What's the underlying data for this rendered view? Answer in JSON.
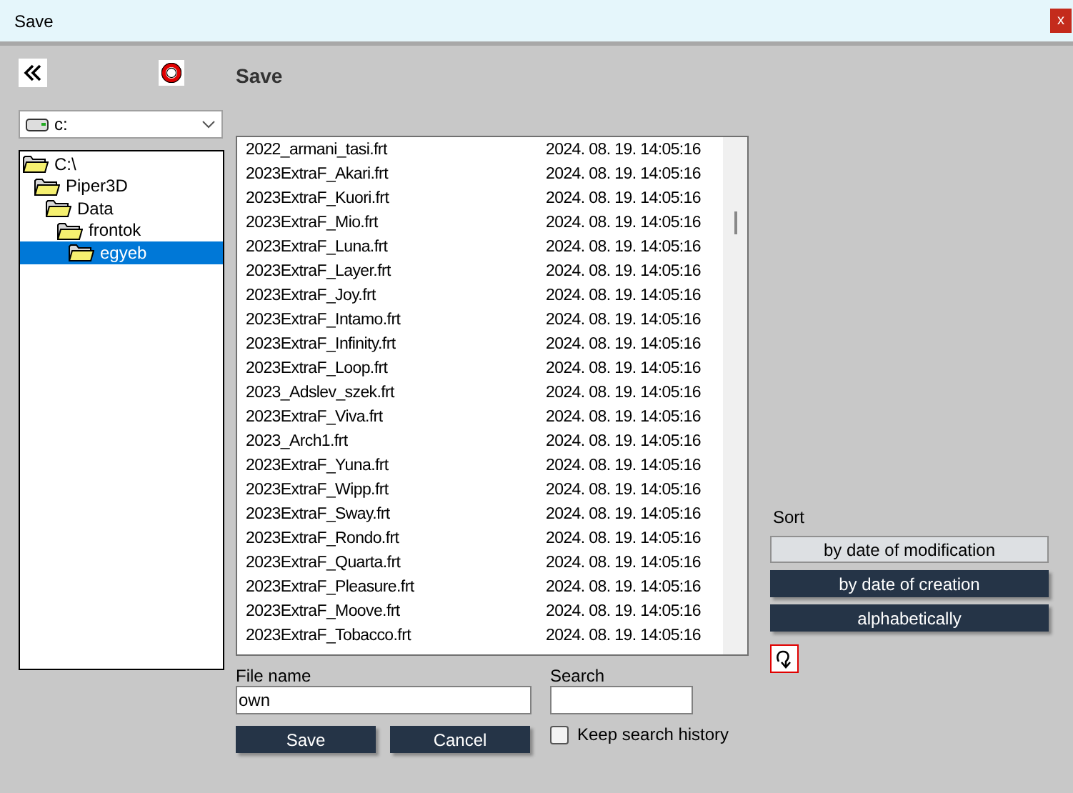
{
  "window": {
    "title": "Save",
    "close": "x"
  },
  "heading": "Save",
  "drive": {
    "value": "c:"
  },
  "tree": [
    {
      "label": "C:\\",
      "selected": false,
      "children": [
        {
          "label": "Piper3D",
          "selected": false,
          "children": [
            {
              "label": "Data",
              "selected": false,
              "children": [
                {
                  "label": "frontok",
                  "selected": false,
                  "children": [
                    {
                      "label": "egyeb",
                      "selected": true
                    }
                  ]
                }
              ]
            }
          ]
        }
      ]
    }
  ],
  "files": [
    {
      "name": "2022_armani_tasi.frt",
      "date": "2024. 08. 19. 14:05:16"
    },
    {
      "name": "2023ExtraF_Akari.frt",
      "date": "2024. 08. 19. 14:05:16"
    },
    {
      "name": "2023ExtraF_Kuori.frt",
      "date": "2024. 08. 19. 14:05:16"
    },
    {
      "name": "2023ExtraF_Mio.frt",
      "date": "2024. 08. 19. 14:05:16"
    },
    {
      "name": "2023ExtraF_Luna.frt",
      "date": "2024. 08. 19. 14:05:16"
    },
    {
      "name": "2023ExtraF_Layer.frt",
      "date": "2024. 08. 19. 14:05:16"
    },
    {
      "name": "2023ExtraF_Joy.frt",
      "date": "2024. 08. 19. 14:05:16"
    },
    {
      "name": "2023ExtraF_Intamo.frt",
      "date": "2024. 08. 19. 14:05:16"
    },
    {
      "name": "2023ExtraF_Infinity.frt",
      "date": "2024. 08. 19. 14:05:16"
    },
    {
      "name": "2023ExtraF_Loop.frt",
      "date": "2024. 08. 19. 14:05:16"
    },
    {
      "name": "2023_Adslev_szek.frt",
      "date": "2024. 08. 19. 14:05:16"
    },
    {
      "name": "2023ExtraF_Viva.frt",
      "date": "2024. 08. 19. 14:05:16"
    },
    {
      "name": "2023_Arch1.frt",
      "date": "2024. 08. 19. 14:05:16"
    },
    {
      "name": "2023ExtraF_Yuna.frt",
      "date": "2024. 08. 19. 14:05:16"
    },
    {
      "name": "2023ExtraF_Wipp.frt",
      "date": "2024. 08. 19. 14:05:16"
    },
    {
      "name": "2023ExtraF_Sway.frt",
      "date": "2024. 08. 19. 14:05:16"
    },
    {
      "name": "2023ExtraF_Rondo.frt",
      "date": "2024. 08. 19. 14:05:16"
    },
    {
      "name": "2023ExtraF_Quarta.frt",
      "date": "2024. 08. 19. 14:05:16"
    },
    {
      "name": "2023ExtraF_Pleasure.frt",
      "date": "2024. 08. 19. 14:05:16"
    },
    {
      "name": "2023ExtraF_Moove.frt",
      "date": "2024. 08. 19. 14:05:16"
    },
    {
      "name": "2023ExtraF_Tobacco.frt",
      "date": "2024. 08. 19. 14:05:16"
    }
  ],
  "file_name": {
    "label": "File name",
    "value": "own"
  },
  "search": {
    "label": "Search"
  },
  "keep_history": {
    "label": "Keep search history",
    "checked": false
  },
  "buttons": [
    "Save",
    "Cancel"
  ],
  "sort": {
    "label": "Sort",
    "options": [
      {
        "label": "by date of modification",
        "selected": true
      },
      {
        "label": "by date of creation",
        "selected": false
      },
      {
        "label": "alphabetically",
        "selected": false
      }
    ]
  }
}
